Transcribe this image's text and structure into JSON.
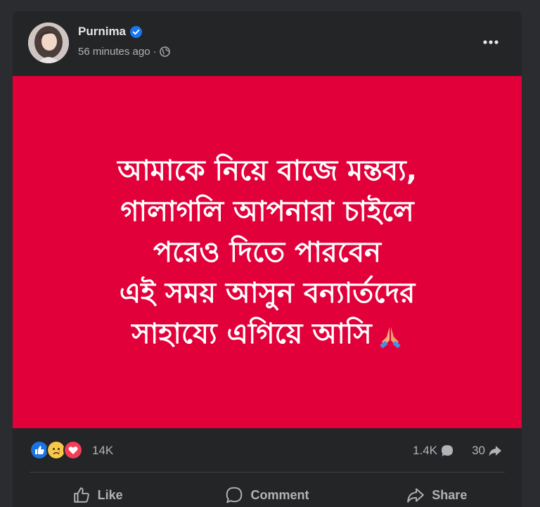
{
  "post": {
    "author": "Purnima",
    "timestamp": "56 minutes ago",
    "separator": "·",
    "audience_icon": "globe-icon",
    "more_icon": "more-horizontal-icon",
    "verified_icon": "verified-badge-icon"
  },
  "image": {
    "background_color": "#e2003a",
    "lines": [
      "আমাকে নিয়ে বাজে মন্তব্য,",
      "গালাগলি আপনারা চাইলে",
      "পরেও দিতে পারবেন",
      "এই সময় আসুন বন্যার্তদের",
      "সাহায্যে এগিয়ে আসি"
    ],
    "emoji": "folded-hands-emoji"
  },
  "stats": {
    "reaction_icons": [
      "like-reaction-icon",
      "sad-reaction-icon",
      "love-reaction-icon"
    ],
    "reactions": "14K",
    "comments": "1.4K",
    "shares": "30"
  },
  "actions": {
    "like": "Like",
    "comment": "Comment",
    "share": "Share"
  },
  "colors": {
    "card_bg": "#242526",
    "text_primary": "#e4e6eb",
    "text_secondary": "#b0b3b8",
    "verified": "#1877f2"
  }
}
